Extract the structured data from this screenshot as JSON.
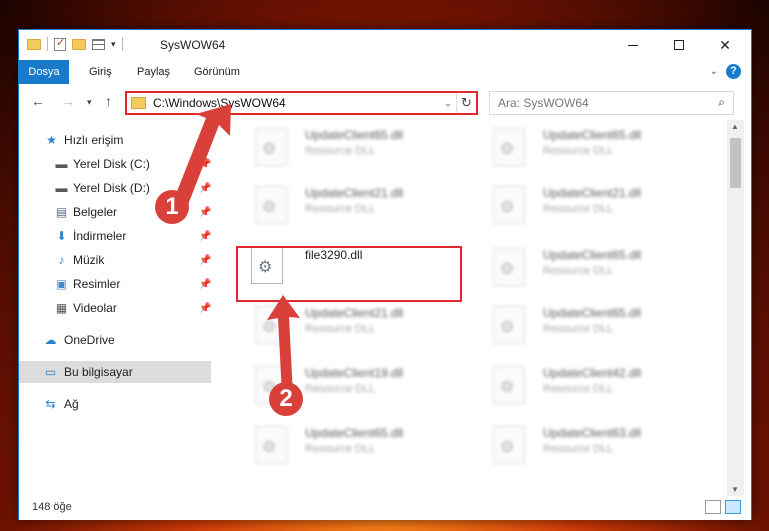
{
  "window": {
    "title": "SysWOW64",
    "accent": "#1979ca"
  },
  "ribbon": {
    "tabs": [
      "Dosya",
      "Giriş",
      "Paylaş",
      "Görünüm"
    ],
    "help_label": "?"
  },
  "address": {
    "path": "C:\\Windows\\SysWOW64",
    "search_placeholder": "Ara: SysWOW64"
  },
  "sidebar": {
    "quick_access": "Hızlı erişim",
    "items": [
      {
        "label": "Yerel Disk (C:)",
        "icon": "drive-icon",
        "pinned": true
      },
      {
        "label": "Yerel Disk (D:)",
        "icon": "drive-icon",
        "pinned": true
      },
      {
        "label": "Belgeler",
        "icon": "documents-icon",
        "pinned": true
      },
      {
        "label": "İndirmeler",
        "icon": "downloads-icon",
        "pinned": true
      },
      {
        "label": "Müzik",
        "icon": "music-icon",
        "pinned": true
      },
      {
        "label": "Resimler",
        "icon": "pictures-icon",
        "pinned": true
      },
      {
        "label": "Videolar",
        "icon": "videos-icon",
        "pinned": true
      }
    ],
    "onedrive": "OneDrive",
    "this_pc": "Bu bilgisayar",
    "network": "Ağ"
  },
  "files": [
    {
      "name": "UpdateClient65.dll",
      "type": "Resource DLL"
    },
    {
      "name": "UpdateClient65.dll",
      "type": "Resource DLL"
    },
    {
      "name": "UpdateClient21.dll",
      "type": "Resource DLL"
    },
    {
      "name": "UpdateClient21.dll",
      "type": "Resource DLL"
    },
    {
      "name": "file3290.dll",
      "type": ""
    },
    {
      "name": "UpdateClient65.dll",
      "type": "Resource DLL"
    },
    {
      "name": "UpdateClient21.dll",
      "type": "Resource DLL"
    },
    {
      "name": "UpdateClient65.dll",
      "type": "Resource DLL"
    },
    {
      "name": "UpdateClient19.dll",
      "type": "Resource DLL"
    },
    {
      "name": "UpdateClient42.dll",
      "type": "Resource DLL"
    },
    {
      "name": "UpdateClient65.dll",
      "type": "Resource DLL"
    },
    {
      "name": "UpdateClient63.dll",
      "type": "Resource DLL"
    }
  ],
  "status": {
    "count": "148 öğe"
  },
  "annotations": {
    "step1": "1",
    "step2": "2",
    "color": "#d9403a"
  }
}
